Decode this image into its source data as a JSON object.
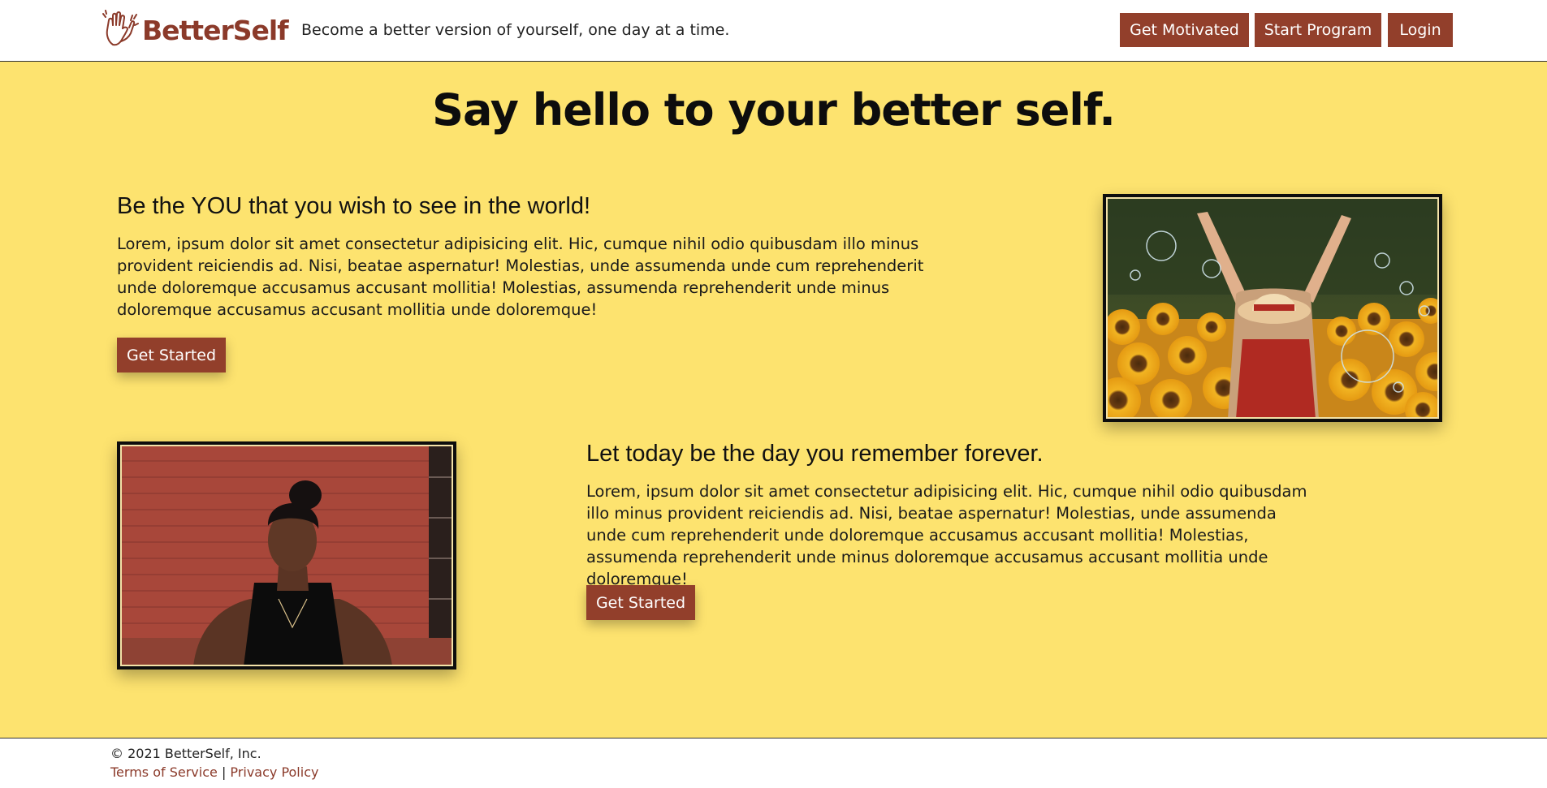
{
  "header": {
    "brand": "BetterSelf",
    "logo_icon": "clapping-hands-icon",
    "tagline": "Become a better version of yourself, one day at a time.",
    "nav": [
      {
        "label": "Get Motivated"
      },
      {
        "label": "Start Program"
      },
      {
        "label": "Login"
      }
    ]
  },
  "main": {
    "hero_title": "Say hello to your better self.",
    "sections": [
      {
        "heading": "Be the YOU that you wish to see in the world!",
        "body": "Lorem, ipsum dolor sit amet consectetur adipisicing elit. Hic, cumque nihil odio quibusdam illo minus provident reiciendis ad. Nisi, beatae aspernatur! Molestias, unde assumenda unde cum reprehenderit unde doloremque accusamus accusant mollitia! Molestias, assumenda reprehenderit unde minus doloremque accusamus accusant mollitia unde doloremque!",
        "button": "Get Started"
      },
      {
        "heading": "Let today be the day you remember forever.",
        "body": "Lorem, ipsum dolor sit amet consectetur adipisicing elit. Hic, cumque nihil odio quibusdam illo minus provident reiciendis ad. Nisi, beatae aspernatur! Molestias, unde assumenda unde cum reprehenderit unde doloremque accusamus accusant mollitia! Molestias, assumenda reprehenderit unde minus doloremque accusamus accusant mollitia unde doloremque!",
        "button": "Get Started"
      }
    ]
  },
  "footer": {
    "copyright": "© 2021 BetterSelf, Inc.",
    "terms": "Terms of Service",
    "separator": "|",
    "privacy": "Privacy Policy"
  },
  "colors": {
    "accent": "#923f2b",
    "background": "#fde36f",
    "brand_text": "#8b3a2a"
  }
}
